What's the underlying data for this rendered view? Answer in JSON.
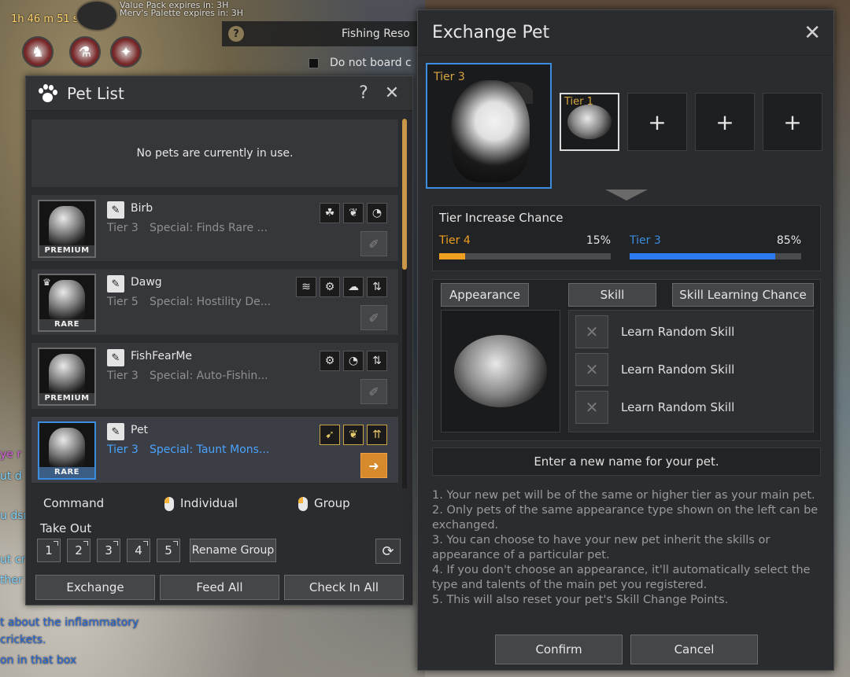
{
  "hud": {
    "buff_timer": "1h 46 m 51 s",
    "buff_line1": "Value Pack expires in: 3H",
    "buff_line2": "Merv's Palette expires in: 3H",
    "fishing_label": "Fishing Reso",
    "board_label": "Do not board c",
    "chat": [
      "ye r",
      "ut d",
      "u dsr",
      "ut cr",
      "ther",
      "t about the inflammatory",
      "crickets.",
      "on in that box"
    ]
  },
  "pet_list": {
    "title": "Pet List",
    "help_glyph": "?",
    "close_glyph": "✕",
    "no_pets_text": "No pets are currently in use.",
    "pets": [
      {
        "name": "Birb",
        "tier": "Tier 3",
        "special": "Special: Finds Rare ...",
        "badge": "PREMIUM",
        "skills": [
          "☘",
          "❦",
          "◔"
        ]
      },
      {
        "name": "Dawg",
        "tier": "Tier 5",
        "special": "Special: Hostility De...",
        "badge": "RARE",
        "skills": [
          "≋",
          "⚙",
          "☁",
          "⇅"
        ]
      },
      {
        "name": "FishFearMe",
        "tier": "Tier 3",
        "special": "Special: Auto-Fishin...",
        "badge": "PREMIUM",
        "skills": [
          "⚙",
          "◔",
          "⇅"
        ]
      },
      {
        "name": "Pet",
        "tier": "Tier 3",
        "special": "Special: Taunt Mons...",
        "badge": "RARE",
        "skills": [
          "➹",
          "❦",
          "⇈"
        ]
      }
    ],
    "command_label": "Command",
    "individual_label": "Individual",
    "group_label": "Group",
    "take_out_label": "Take Out",
    "groups": [
      "1",
      "2",
      "3",
      "4",
      "5"
    ],
    "rename_group": "Rename Group",
    "refresh_glyph": "⟳",
    "exchange_btn": "Exchange",
    "feed_all_btn": "Feed All",
    "check_in_all_btn": "Check In All"
  },
  "exchange": {
    "title": "Exchange Pet",
    "close_glyph": "✕",
    "main_tier": "Tier 3",
    "material_tier": "Tier 1",
    "plus_glyph": "+",
    "chance_header": "Tier Increase Chance",
    "chance": [
      {
        "label": "Tier 4",
        "percent": "15%",
        "value": 0.15,
        "color": "#f0a020"
      },
      {
        "label": "Tier 3",
        "percent": "85%",
        "value": 0.85,
        "color": "#2a7bf0"
      }
    ],
    "appearance_btn": "Appearance",
    "skill_btn": "Skill",
    "skill_chance_btn": "Skill Learning Chance",
    "skills": [
      "Learn Random Skill",
      "Learn Random Skill",
      "Learn Random Skill"
    ],
    "name_placeholder": "Enter a new name for your pet.",
    "notes": [
      "1. Your new pet will be of the same or higher tier as your main pet.",
      "2. Only pets of the same appearance type shown on the left can be exchanged.",
      "3. You can choose to have your new pet inherit the skills or appearance of a particular pet.",
      "4. If you don't choose an appearance, it'll automatically select the type and talents of the main pet you registered.",
      "5. This will also reset your pet's Skill Change Points."
    ],
    "confirm": "Confirm",
    "cancel": "Cancel"
  }
}
